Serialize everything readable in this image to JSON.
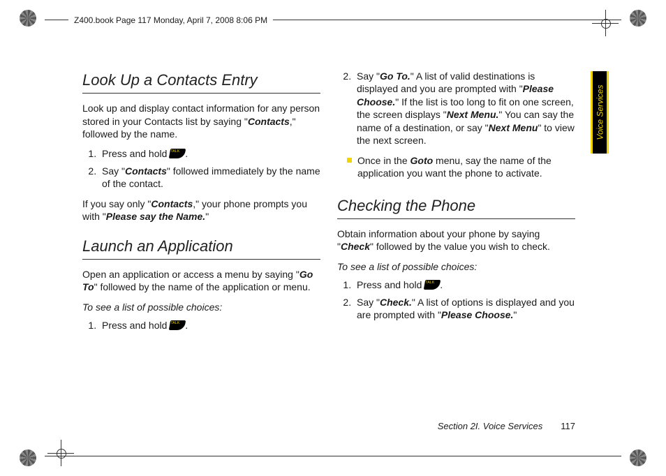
{
  "header": {
    "meta_line": "Z400.book  Page 117  Monday, April 7, 2008  8:06 PM"
  },
  "side_tab": {
    "label": "Voice Services"
  },
  "left": {
    "h1": "Look Up a Contacts Entry",
    "p1_a": "Look up and display contact information for any person stored in your Contacts list by saying \"",
    "p1_cmd": "Contacts",
    "p1_b": ",\" followed by the name.",
    "ol": {
      "li1_a": "Press and hold ",
      "li1_b": ".",
      "li2_a": "Say \"",
      "li2_cmd": "Contacts",
      "li2_b": "\" followed immediately by the name of the contact."
    },
    "p2_a": "If you say only \"",
    "p2_cmd1": "Contacts",
    "p2_b": ",\" your phone prompts you with \"",
    "p2_cmd2": "Please say the Name.",
    "p2_c": "\"",
    "h2": "Launch an Application",
    "p3_a": "Open an application or access a menu by saying \"",
    "p3_cmd": "Go To",
    "p3_b": "\" followed by the name of the application or menu.",
    "sub1": "To see a list of possible choices:",
    "ol2": {
      "li1_a": "Press and hold ",
      "li1_b": "."
    }
  },
  "right": {
    "ol_start": {
      "li2_a": "Say \"",
      "li2_cmd1": "Go To.",
      "li2_b": "\" A list of valid destinations is displayed and you are prompted with \"",
      "li2_cmd2": "Please Choose.",
      "li2_c": "\" If the list is too long to fit on one screen, the screen displays \"",
      "li2_cmd3": "Next Menu.",
      "li2_d": "\" You can say the name of a destination, or say \"",
      "li2_cmd4": "Next Menu",
      "li2_e": "\" to view the next screen."
    },
    "bullet_a": "Once in the ",
    "bullet_cmd": "Goto",
    "bullet_b": " menu, say the name of the application you want the phone to activate.",
    "h1": "Checking the Phone",
    "p1_a": "Obtain information about your phone by saying \"",
    "p1_cmd": "Check",
    "p1_b": "\" followed by the value you wish to check.",
    "sub1": "To see a list of possible choices:",
    "ol2": {
      "li1_a": "Press and hold ",
      "li1_b": ".",
      "li2_a": "Say \"",
      "li2_cmd1": "Check.",
      "li2_b": "\" A list of options is displayed and you are prompted with \"",
      "li2_cmd2": "Please Choose.",
      "li2_c": "\""
    }
  },
  "footer": {
    "section": "Section 2I. Voice Services",
    "page": "117"
  }
}
